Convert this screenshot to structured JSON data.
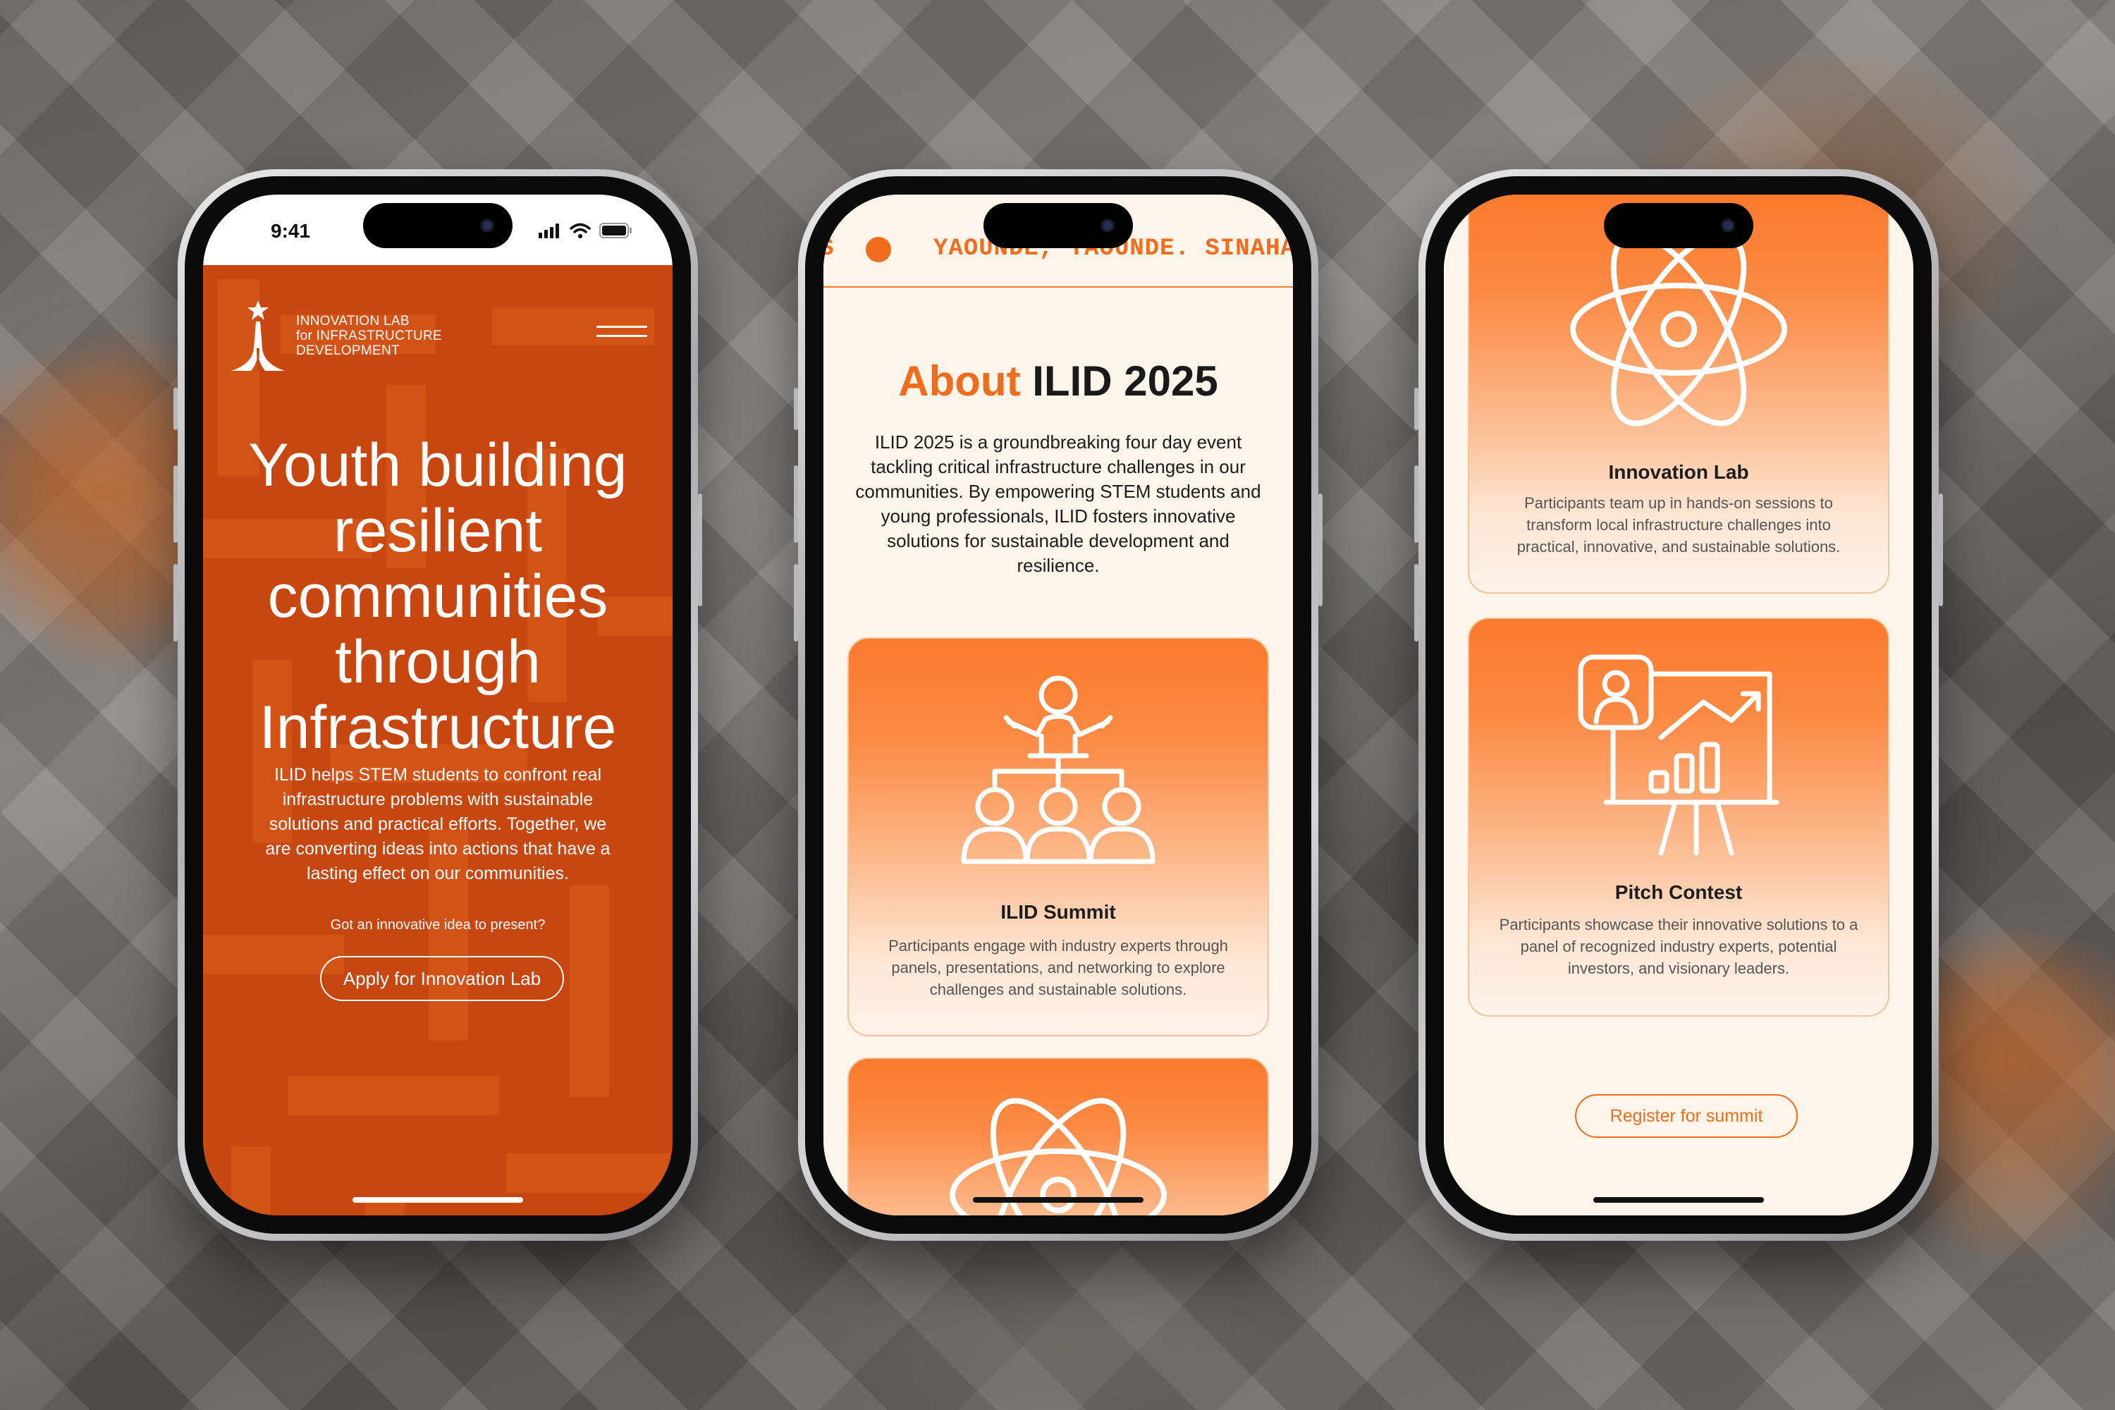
{
  "phone1": {
    "status_time": "9:41",
    "logo_line1": "INNOVATION LAB",
    "logo_line2": "for INFRASTRUCTURE",
    "logo_line3": "DEVELOPMENT",
    "hero_line1": "Youth building",
    "hero_line2": "resilient",
    "hero_line3": "communities",
    "hero_line4": "through",
    "hero_line5": "Infrastructure",
    "hero_body": "ILID helps STEM students to confront real infrastructure problems with  sustainable solutions and practical efforts. Together, we are converting ideas into actions that have a lasting effect on our communities.",
    "cta_prompt": "Got an innovative idea to present?",
    "cta_button": "Apply for Innovation Lab"
  },
  "phone2": {
    "ticker_lead": "S",
    "ticker_text": "YAOUNDE, YAOUNDE. SINAHA",
    "about_accent": "About",
    "about_rest": "ILID 2025",
    "about_body": "ILID 2025 is a groundbreaking four day event tackling critical infrastructure challenges in our communities. By empowering STEM students and young professionals, ILID fosters innovative solutions for sustainable development and resilience.",
    "card1_title": "ILID Summit",
    "card1_body": "Participants engage with industry experts through panels, presentations, and networking to explore challenges and sustainable solutions."
  },
  "phone3": {
    "card1_title": "Innovation Lab",
    "card1_body": "Participants team up in hands-on sessions to transform local infrastructure challenges into practical, innovative, and sustainable solutions.",
    "card2_title": "Pitch Contest",
    "card2_body": "Participants showcase their innovative solutions to a panel of  recognized industry experts, potential investors, and visionary leaders.",
    "register_button": "Register for summit"
  },
  "icons": {
    "logo": "tower-star-icon",
    "menu": "hamburger-menu-icon",
    "signal": "signal-icon",
    "wifi": "wifi-icon",
    "battery": "battery-icon",
    "summit": "speaker-audience-icon",
    "lab": "atom-icon",
    "pitch": "presentation-chart-icon"
  },
  "colors": {
    "brand_orange": "#f16d1e",
    "hero_bg": "#c8460f",
    "cream": "#fdf5ea"
  }
}
